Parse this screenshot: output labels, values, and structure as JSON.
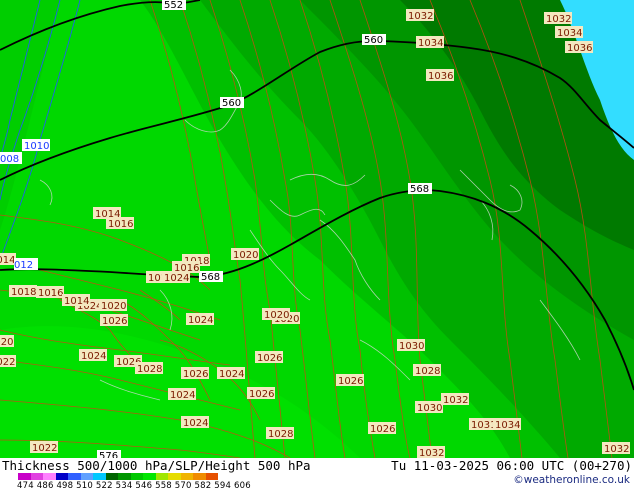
{
  "map": {
    "thickness_bands": [
      {
        "min": 534,
        "max": 546,
        "color": "#00dd00"
      },
      {
        "min": 546,
        "max": 558,
        "color": "#00bb00"
      },
      {
        "min": 558,
        "max": 570,
        "color": "#00990a"
      },
      {
        "min": 570,
        "max": 582,
        "color": "#006e00"
      },
      {
        "min": 582,
        "max": 594,
        "color": "#33ccff"
      }
    ],
    "height_500_labels": [
      "552",
      "560",
      "560",
      "568",
      "568",
      "576"
    ],
    "slp_labels": [
      "1032",
      "1032",
      "1034",
      "1034",
      "1036",
      "1036",
      "1014",
      "1016",
      "1014",
      "1020",
      "1018",
      "1016",
      "1012",
      "1024",
      "1024",
      "1020",
      "1018",
      "1016",
      "1014",
      "1024",
      "1020",
      "1026",
      "1024",
      "1020",
      "1020",
      "1022",
      "1024",
      "1026",
      "1028",
      "1026",
      "1026",
      "1024",
      "1026",
      "1024",
      "1026",
      "1024",
      "1030",
      "1028",
      "1030",
      "1032",
      "1026",
      "1031",
      "1034",
      "1028",
      "1022",
      "1032",
      "1032",
      "1020"
    ],
    "low_pressure_labels": [
      "1010",
      "008",
      "012",
      "014"
    ]
  },
  "footer": {
    "title": "Thickness 500/1000 hPa/SLP/Height 500 hPa",
    "datetime": "Tu 11-03-2025 06:00 UTC (00+270)",
    "credit": "©weatheronline.co.uk",
    "legend_ticks": [
      "474",
      "486",
      "498",
      "510",
      "522",
      "534",
      "546",
      "558",
      "570",
      "582",
      "594",
      "606"
    ],
    "legend_colors": [
      "#c800c8",
      "#e040e0",
      "#ff80ff",
      "#0000c8",
      "#3060ff",
      "#60a0ff",
      "#00c8ff",
      "#006400",
      "#009600",
      "#00c800",
      "#00e600",
      "#a0e600",
      "#e6dc00",
      "#f0b400",
      "#f08c00",
      "#e65000"
    ]
  }
}
